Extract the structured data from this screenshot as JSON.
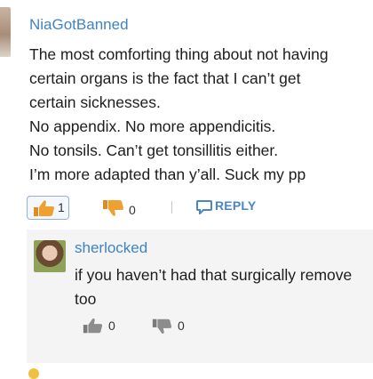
{
  "comment": {
    "username": "NiaGotBanned",
    "lines": [
      "The most comforting thing about not having",
      "certain organs is the fact that I can’t get",
      "certain sicknesses.",
      "No appendix. No more appendicitis.",
      "No tonsils. Can’t get tonsillitis either.",
      "I’m more adapted than y’all. Suck my pp"
    ],
    "upvotes": "1",
    "downvotes": "0",
    "reply_label": "REPLY",
    "upvote_color": "#f0a030",
    "downvote_color": "#f0a030"
  },
  "reply": {
    "username": "sherlocked",
    "lines": [
      "if you haven’t had that surgically remove",
      "too"
    ],
    "upvotes": "0",
    "downvotes": "0",
    "vote_icon_color": "#8c8c8c"
  },
  "colors": {
    "username": "#3f83bf",
    "reply_box_bg": "#f4f4f4"
  }
}
